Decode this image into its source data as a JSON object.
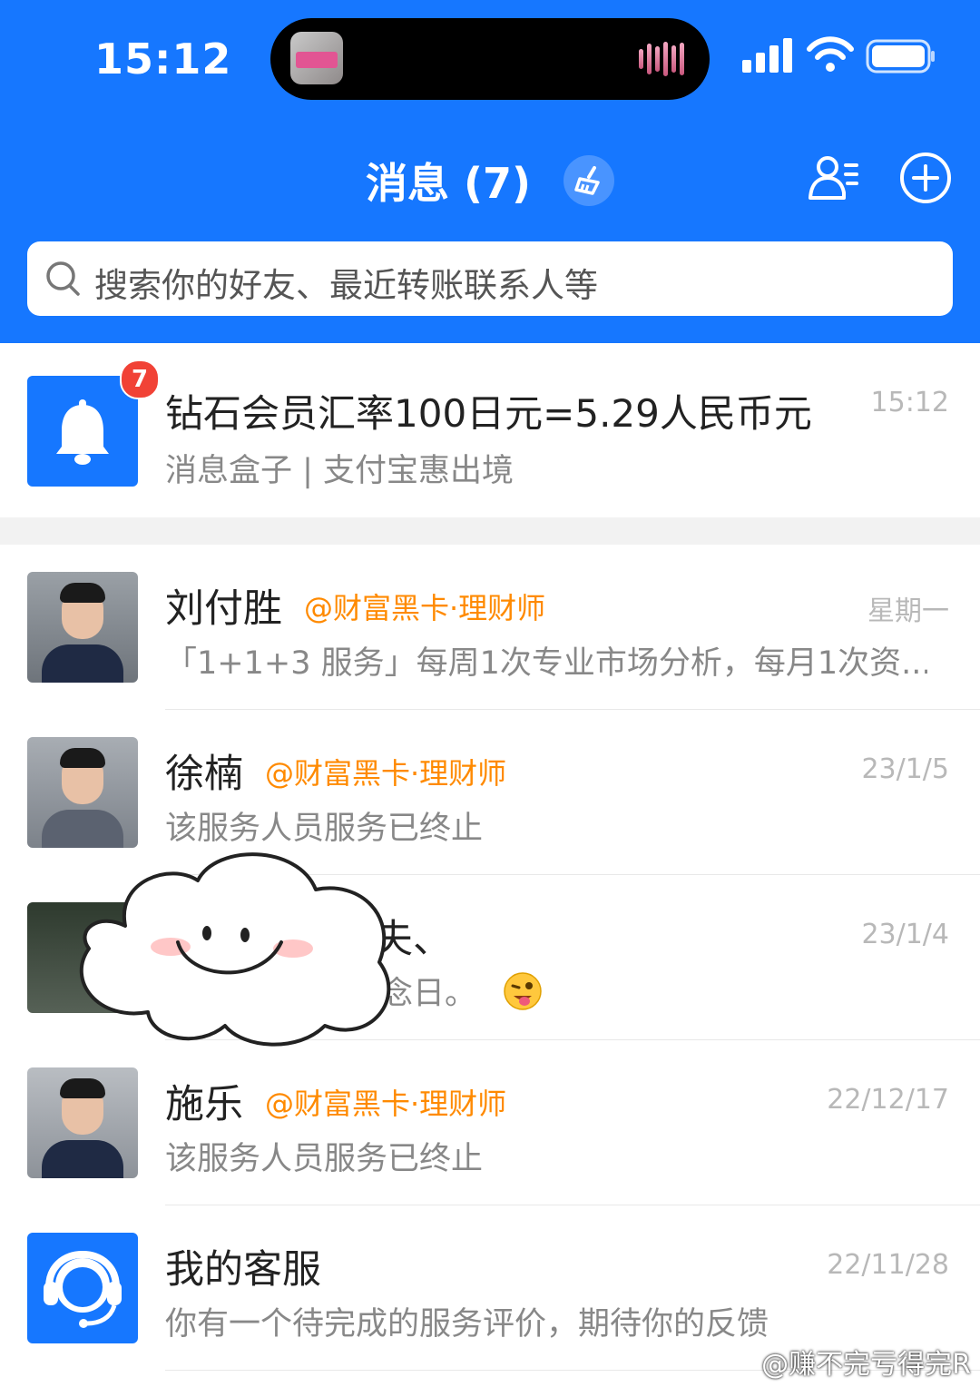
{
  "status_bar": {
    "time": "15:12"
  },
  "header": {
    "title": "消息 (7)",
    "search_placeholder": "搜索你的好友、最近转账联系人等"
  },
  "notification": {
    "badge": "7",
    "title": "钻石会员汇率100日元=5.29人民币元",
    "subtitle": "消息盒子 | 支付宝惠出境",
    "time": "15:12"
  },
  "conversations": [
    {
      "name": "刘付胜",
      "tag": "@财富黑卡·理财师",
      "preview": "「1+1+3 服务」每周1次专业市场分析，每月1次资...",
      "time": "星期一"
    },
    {
      "name": "徐楠",
      "tag": "@财富黑卡·理财师",
      "preview": "该服务人员服务已终止",
      "time": "23/1/5"
    },
    {
      "name": "夫、",
      "tag": "",
      "preview": "念日。",
      "time": "23/1/4"
    },
    {
      "name": "施乐",
      "tag": "@财富黑卡·理财师",
      "preview": "该服务人员服务已终止",
      "time": "22/12/17"
    },
    {
      "name": "我的客服",
      "tag": "",
      "preview": "你有一个待完成的服务评价，期待你的反馈",
      "time": "22/11/28"
    }
  ],
  "watermark": "@赚不完亏得完R",
  "colors": {
    "brand": "#1677ff",
    "tag": "#ff8a00",
    "badge": "#f14236"
  }
}
